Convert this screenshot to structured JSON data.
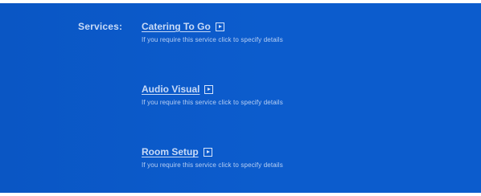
{
  "services_label": "Services:",
  "services": [
    {
      "title": "Catering To Go",
      "description": "If you require this service click to specify details"
    },
    {
      "title": "Audio Visual",
      "description": "If you require this service click to specify details"
    },
    {
      "title": "Room Setup",
      "description": "If you require this service click to specify details"
    }
  ],
  "icons": {
    "arrow": "arrow-right-icon"
  },
  "colors": {
    "panel_background": "#0c5ccd",
    "text": "#c9dbf7"
  }
}
